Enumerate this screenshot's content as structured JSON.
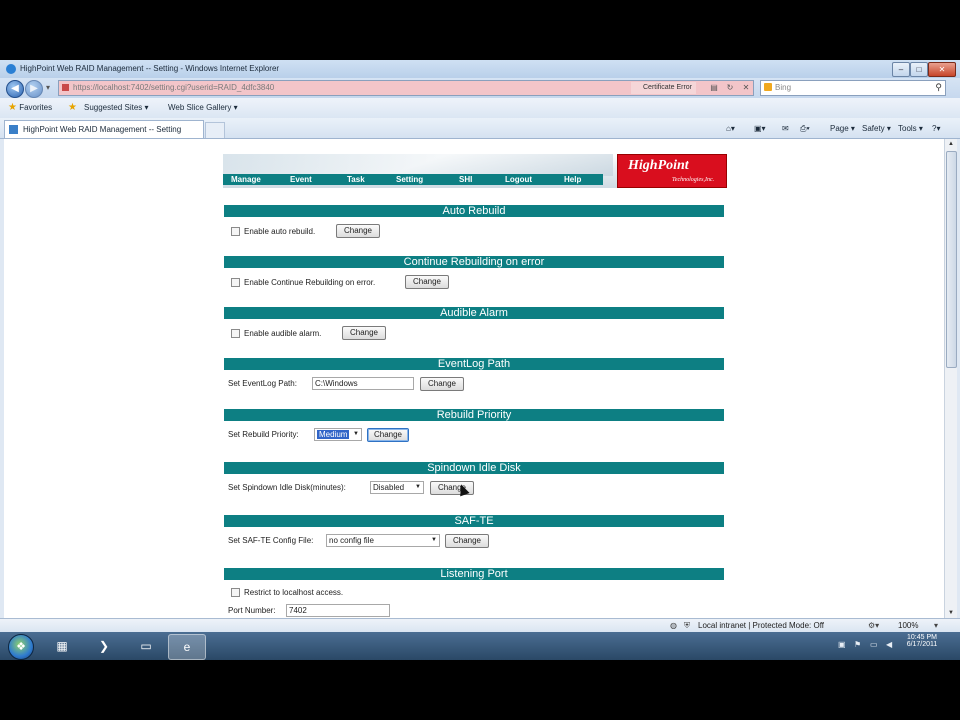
{
  "window": {
    "title": "HighPoint Web RAID Management -- Setting - Windows Internet Explorer",
    "minimize": "–",
    "maximize": "□",
    "close": "✕"
  },
  "address_bar": {
    "url": "https://localhost:7402/setting.cgi?userid=RAID_4dfc3840",
    "cert_error": "Certificate Error",
    "search_placeholder": "Bing"
  },
  "favorites_bar": {
    "favorites": "Favorites",
    "suggested_sites": "Suggested Sites ▾",
    "web_slice_gallery": "Web Slice Gallery ▾"
  },
  "tab": {
    "label": "HighPoint Web RAID Management -- Setting"
  },
  "command_bar": {
    "page": "Page ▾",
    "safety": "Safety ▾",
    "tools": "Tools ▾"
  },
  "banner": {
    "logo_main": "HighPoint",
    "logo_sub": "Technologies,Inc.",
    "menu": [
      "Manage",
      "Event",
      "Task",
      "Setting",
      "SHI",
      "Logout",
      "Help"
    ]
  },
  "sections": {
    "auto_rebuild": {
      "title": "Auto Rebuild",
      "label": "Enable auto rebuild.",
      "button": "Change"
    },
    "continue_rebuilding": {
      "title": "Continue Rebuilding on error",
      "label": "Enable Continue Rebuilding on error.",
      "button": "Change"
    },
    "audible_alarm": {
      "title": "Audible Alarm",
      "label": "Enable audible alarm.",
      "button": "Change"
    },
    "eventlog_path": {
      "title": "EventLog Path",
      "label": "Set EventLog Path:",
      "value": "C:\\Windows",
      "button": "Change"
    },
    "rebuild_priority": {
      "title": "Rebuild Priority",
      "label": "Set Rebuild Priority:",
      "value": "Medium",
      "button": "Change"
    },
    "spindown": {
      "title": "Spindown Idle Disk",
      "label": "Set Spindown Idle Disk(minutes):",
      "value": "Disabled",
      "button": "Change"
    },
    "safte": {
      "title": "SAF-TE",
      "label": "Set SAF-TE Config File:",
      "value": "no config file",
      "button": "Change"
    },
    "listening_port": {
      "title": "Listening Port",
      "label": "Restrict to localhost access.",
      "port_label": "Port Number:",
      "port_value": "7402"
    }
  },
  "status_bar": {
    "zone": "Local intranet | Protected Mode: Off",
    "zoom": "100%"
  },
  "taskbar": {
    "time": "10:45 PM",
    "date": "6/17/2011"
  }
}
